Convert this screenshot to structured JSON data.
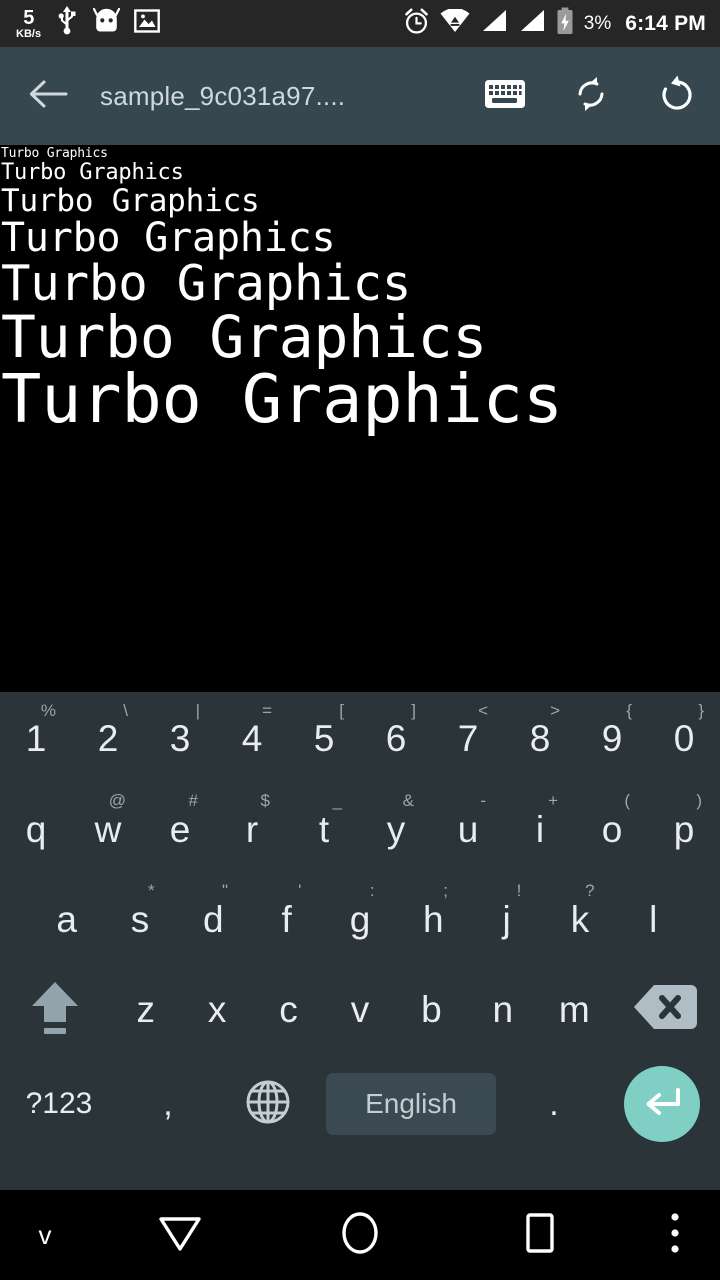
{
  "status_bar": {
    "network_speed_value": "5",
    "network_speed_unit": "KB/s",
    "icons": [
      "usb-icon",
      "android-head-icon",
      "image-icon",
      "alarm-icon",
      "wifi-icon",
      "signal-1-icon",
      "signal-2-icon",
      "battery-charging-icon"
    ],
    "battery_percent": "3%",
    "clock": "6:14 PM",
    "background": "#262626"
  },
  "app_bar": {
    "back_icon": "arrow-left-icon",
    "title": "sample_9c031a97....",
    "actions": [
      {
        "name": "keyboard-icon",
        "label": "keyboard"
      },
      {
        "name": "sync-icon",
        "label": "sync"
      },
      {
        "name": "undo-icon",
        "label": "undo"
      }
    ],
    "background": "#37474F",
    "title_color": "#CFD8DC"
  },
  "content": {
    "background": "#000000",
    "text_color": "#FFFFFF",
    "lines": [
      "Turbo Graphics",
      "Turbo Graphics",
      "Turbo Graphics",
      "Turbo Graphics",
      "Turbo Graphics",
      "Turbo Graphics",
      "Turbo Graphics"
    ]
  },
  "keyboard": {
    "background": "#2A3439",
    "key_text_color": "#E8EDEF",
    "hint_text_color": "#9AA7AD",
    "accent_color": "#7FCFC4",
    "spacebar_color": "#3B4A52",
    "row_numbers": [
      {
        "main": "1",
        "hint": "%"
      },
      {
        "main": "2",
        "hint": "\\"
      },
      {
        "main": "3",
        "hint": "|"
      },
      {
        "main": "4",
        "hint": "="
      },
      {
        "main": "5",
        "hint": "["
      },
      {
        "main": "6",
        "hint": "]"
      },
      {
        "main": "7",
        "hint": "<"
      },
      {
        "main": "8",
        "hint": ">"
      },
      {
        "main": "9",
        "hint": "{"
      },
      {
        "main": "0",
        "hint": "}"
      }
    ],
    "row_top": [
      {
        "main": "q",
        "hint": ""
      },
      {
        "main": "w",
        "hint": "@"
      },
      {
        "main": "e",
        "hint": "#"
      },
      {
        "main": "r",
        "hint": "$"
      },
      {
        "main": "t",
        "hint": "_"
      },
      {
        "main": "y",
        "hint": "&"
      },
      {
        "main": "u",
        "hint": "-"
      },
      {
        "main": "i",
        "hint": "+"
      },
      {
        "main": "o",
        "hint": "("
      },
      {
        "main": "p",
        "hint": ")"
      }
    ],
    "row_home": [
      {
        "main": "a",
        "hint": ""
      },
      {
        "main": "s",
        "hint": "*"
      },
      {
        "main": "d",
        "hint": "\""
      },
      {
        "main": "f",
        "hint": "'"
      },
      {
        "main": "g",
        "hint": ":"
      },
      {
        "main": "h",
        "hint": ";"
      },
      {
        "main": "j",
        "hint": "!"
      },
      {
        "main": "k",
        "hint": "?"
      },
      {
        "main": "l",
        "hint": ""
      }
    ],
    "row_bottom_letters": [
      {
        "main": "z",
        "hint": ""
      },
      {
        "main": "x",
        "hint": ""
      },
      {
        "main": "c",
        "hint": ""
      },
      {
        "main": "v",
        "hint": ""
      },
      {
        "main": "b",
        "hint": ""
      },
      {
        "main": "n",
        "hint": ""
      },
      {
        "main": "m",
        "hint": ""
      }
    ],
    "shift_key": "shift-icon",
    "backspace_key": "backspace-icon",
    "symbols_key": "?123",
    "comma_key": ",",
    "language_key": "globe-icon",
    "spacebar_label": "English",
    "period_key": ".",
    "enter_key": "enter-icon"
  },
  "nav_bar": {
    "background": "#000000",
    "items": [
      {
        "name": "hide-keyboard-icon",
        "glyph": "v"
      },
      {
        "name": "back-icon",
        "glyph": "triangle-down"
      },
      {
        "name": "home-icon",
        "glyph": "circle"
      },
      {
        "name": "recents-icon",
        "glyph": "square"
      },
      {
        "name": "overflow-menu-icon",
        "glyph": "three-dots"
      }
    ]
  }
}
